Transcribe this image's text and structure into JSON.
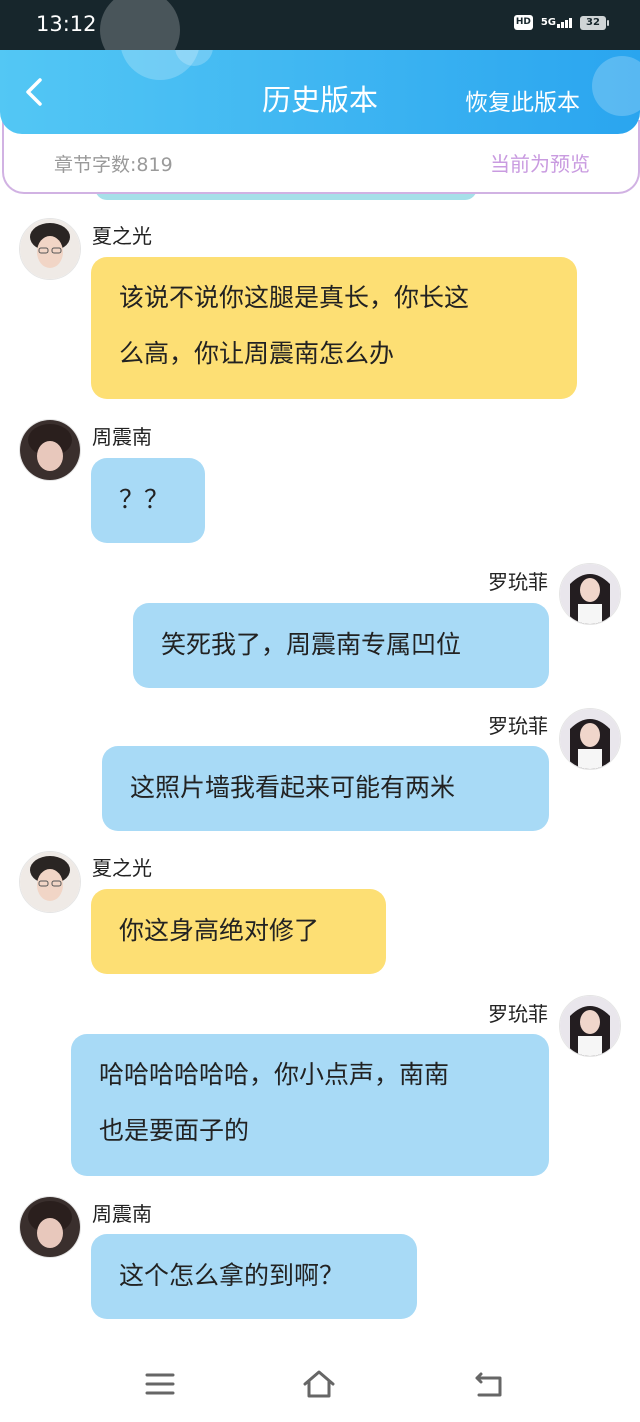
{
  "status_bar": {
    "time": "13:12",
    "network": "5G",
    "battery": "32"
  },
  "header": {
    "title": "历史版本",
    "restore_label": "恢复此版本"
  },
  "info": {
    "word_count": "章节字数:819",
    "preview_status": "当前为预览"
  },
  "messages": [
    {
      "sender": "夏之光",
      "side": "left",
      "color": "yellow",
      "lines": [
        "该说不说你这腿是真长，你长这",
        "么高，你让周震南怎么办"
      ]
    },
    {
      "sender": "周震南",
      "side": "left",
      "color": "blue",
      "lines": [
        "？？"
      ]
    },
    {
      "sender": "罗玧菲",
      "side": "right",
      "color": "blue",
      "lines": [
        "笑死我了，周震南专属凹位"
      ]
    },
    {
      "sender": "罗玧菲",
      "side": "right",
      "color": "blue",
      "lines": [
        "这照片墙我看起来可能有两米"
      ]
    },
    {
      "sender": "夏之光",
      "side": "left",
      "color": "yellow",
      "lines": [
        "你这身高绝对修了"
      ]
    },
    {
      "sender": "罗玧菲",
      "side": "right",
      "color": "blue",
      "lines": [
        "哈哈哈哈哈哈，你小点声，南南",
        "也是要面子的"
      ]
    },
    {
      "sender": "周震南",
      "side": "left",
      "color": "blue",
      "lines": [
        "这个怎么拿的到啊？"
      ]
    }
  ],
  "colors": {
    "yellow_bubble": "#fddf74",
    "blue_bubble": "#a8daf6",
    "header_gradient_start": "#53c7f4",
    "header_gradient_end": "#2aa5ef",
    "preview_text": "#c99be0"
  },
  "icons": {
    "back": "chevron-left-icon",
    "menu": "menu-icon",
    "home": "home-icon",
    "return": "return-icon"
  }
}
